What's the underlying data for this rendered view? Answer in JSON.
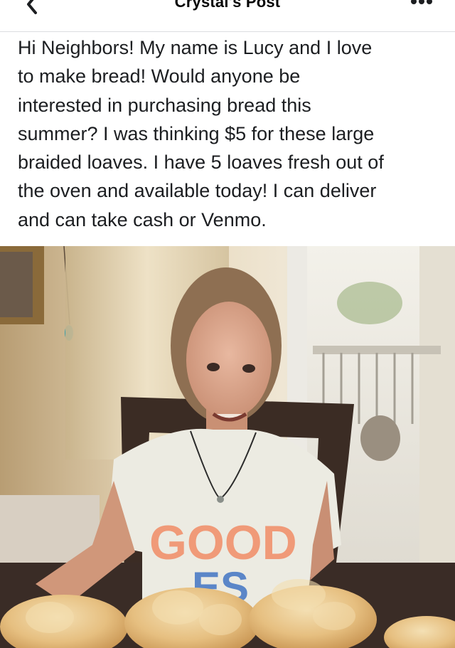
{
  "header": {
    "title": "Crystal's Post",
    "back_icon": "chevron-left-icon",
    "more_icon": "more-horizontal-icon"
  },
  "post": {
    "text": "Hi Neighbors! My name is Lucy and I love\nto make bread! Would anyone be\ninterested in purchasing bread this\nsummer? I was thinking $5 for these large\nbraided loaves. I have 5 loaves fresh out of\nthe oven and available today! I can deliver\nand can take cash or Venmo."
  },
  "photo": {
    "shirt_text_1": "GOOD",
    "shirt_text_2": "ES"
  },
  "colors": {
    "header_border": "#dcdde1",
    "text": "#1c1e21",
    "icon": "#1c1e21"
  }
}
